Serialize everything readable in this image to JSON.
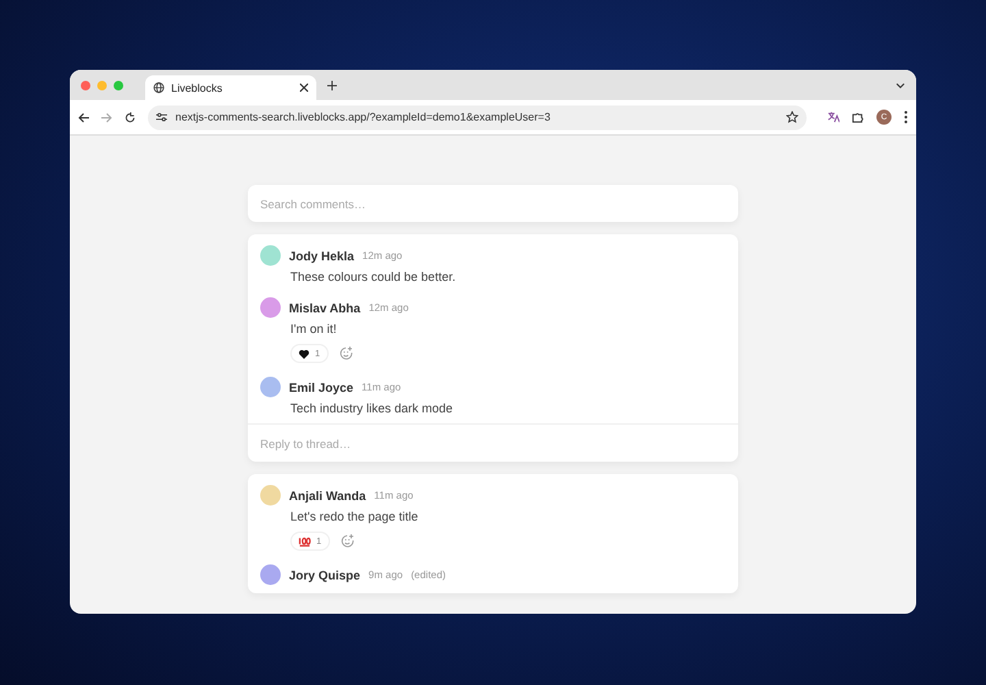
{
  "browser": {
    "tab_title": "Liveblocks",
    "url": "nextjs-comments-search.liveblocks.app/?exampleId=demo1&exampleUser=3",
    "profile_initial": "C"
  },
  "search": {
    "placeholder": "Search comments…"
  },
  "threads": [
    {
      "comments": [
        {
          "author": "Jody Hekla",
          "time": "12m ago",
          "body": "These colours could be better.",
          "color": "#9fe3d2"
        },
        {
          "author": "Mislav Abha",
          "time": "12m ago",
          "body": "I'm on it!",
          "color": "#d99be8",
          "reactions": [
            {
              "kind": "heart",
              "count": "1"
            }
          ]
        },
        {
          "author": "Emil Joyce",
          "time": "11m ago",
          "body": "Tech industry likes dark mode",
          "color": "#a9bdf0"
        }
      ],
      "reply_placeholder": "Reply to thread…"
    },
    {
      "comments": [
        {
          "author": "Anjali Wanda",
          "time": "11m ago",
          "body": "Let's redo the page title",
          "color": "#f0d9a0",
          "reactions": [
            {
              "kind": "hundred",
              "count": "1"
            }
          ]
        },
        {
          "author": "Jory Quispe",
          "time": "9m ago",
          "edited": "(edited)",
          "color": "#a9a9f0"
        }
      ]
    }
  ]
}
